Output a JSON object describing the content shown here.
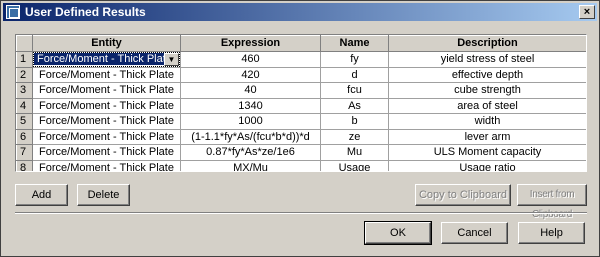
{
  "window": {
    "title": "User Defined Results",
    "close_glyph": "×"
  },
  "grid": {
    "columns": [
      "Entity",
      "Expression",
      "Name",
      "Description"
    ],
    "rows": [
      {
        "num": "1",
        "entity": "Force/Moment - Thick Plate",
        "expression": "460",
        "name": "fy",
        "description": "yield stress of steel"
      },
      {
        "num": "2",
        "entity": "Force/Moment - Thick Plate",
        "expression": "420",
        "name": "d",
        "description": "effective depth"
      },
      {
        "num": "3",
        "entity": "Force/Moment - Thick Plate",
        "expression": "40",
        "name": "fcu",
        "description": "cube strength"
      },
      {
        "num": "4",
        "entity": "Force/Moment - Thick Plate",
        "expression": "1340",
        "name": "As",
        "description": "area of steel"
      },
      {
        "num": "5",
        "entity": "Force/Moment - Thick Plate",
        "expression": "1000",
        "name": "b",
        "description": "width"
      },
      {
        "num": "6",
        "entity": "Force/Moment - Thick Plate",
        "expression": "(1-1.1*fy*As/(fcu*b*d))*d",
        "name": "ze",
        "description": "lever arm"
      },
      {
        "num": "7",
        "entity": "Force/Moment - Thick Plate",
        "expression": "0.87*fy*As*ze/1e6",
        "name": "Mu",
        "description": "ULS Moment capacity"
      },
      {
        "num": "8",
        "entity": "Force/Moment - Thick Plate",
        "expression": "MX/Mu",
        "name": "Usage",
        "description": "Usage ratio"
      }
    ]
  },
  "buttons": {
    "add": "Add",
    "delete": "Delete",
    "copy": "Copy to Clipboard",
    "insert": "Insert from Clipboard",
    "ok": "OK",
    "cancel": "Cancel",
    "help": "Help"
  },
  "icons": {
    "dropdown": "▼"
  }
}
